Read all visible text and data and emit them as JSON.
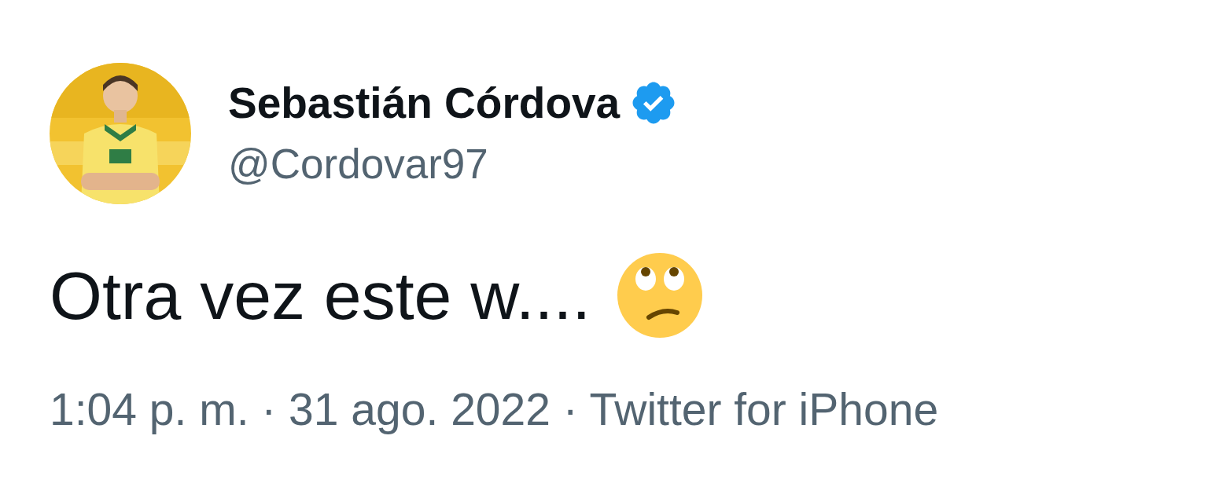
{
  "author": {
    "name": "Sebastián Córdova",
    "handle": "@Cordovar97",
    "verified": true
  },
  "tweet": {
    "text": "Otra vez este w....",
    "emoji": {
      "kind": "eyeroll"
    }
  },
  "meta": "1:04 p. m. · 31 ago. 2022 · Twitter for iPhone"
}
